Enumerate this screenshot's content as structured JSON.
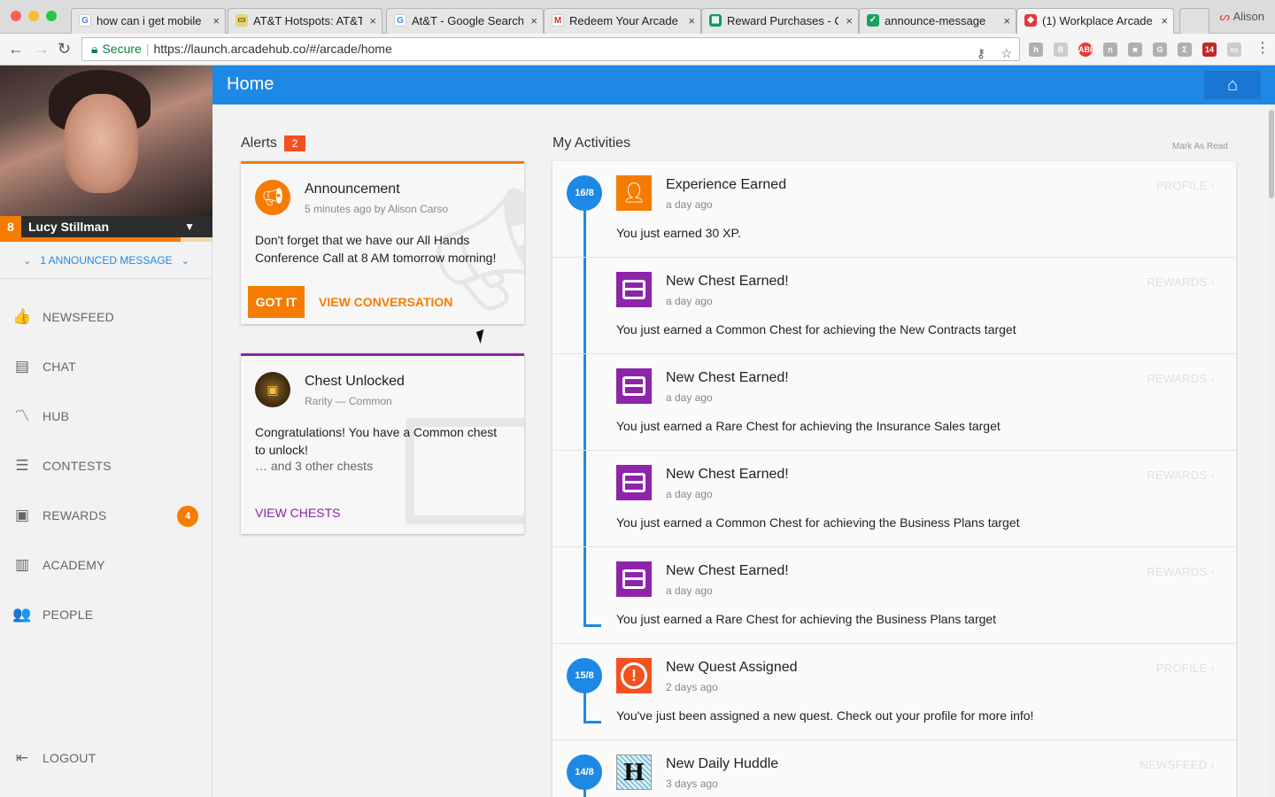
{
  "browser": {
    "tabs": [
      {
        "title": "how can i get mobile",
        "favicon": "google-icon",
        "color": "#4285f4"
      },
      {
        "title": "AT&T Hotspots: AT&T",
        "favicon": "ticket-icon",
        "color": "#c8a400"
      },
      {
        "title": "At&T - Google Search",
        "favicon": "google-icon",
        "color": "#4285f4"
      },
      {
        "title": "Redeem Your Arcade",
        "favicon": "gmail-icon",
        "color": "#d93025"
      },
      {
        "title": "Reward Purchases - C",
        "favicon": "sheets-icon",
        "color": "#0f9d58"
      },
      {
        "title": "announce-message",
        "favicon": "checkmark-icon",
        "color": "#1aa260"
      },
      {
        "title": "(1) Workplace Arcade",
        "favicon": "arcade-icon",
        "color": "#e53935"
      }
    ],
    "profile_name": "Alison",
    "secure_label": "Secure",
    "url": "https://launch.arcadehub.co/#/arcade/home"
  },
  "user": {
    "name": "Lucy Stillman",
    "level": "8",
    "xp_progress": 0.85
  },
  "sidebar": {
    "announced_message": "1 ANNOUNCED MESSAGE",
    "items": [
      {
        "label": "NEWSFEED",
        "icon": "thumbs-up-icon",
        "glyph": "👍"
      },
      {
        "label": "CHAT",
        "icon": "chat-icon",
        "glyph": "▤"
      },
      {
        "label": "HUB",
        "icon": "trending-icon",
        "glyph": "〽"
      },
      {
        "label": "CONTESTS",
        "icon": "list-icon",
        "glyph": "☰"
      },
      {
        "label": "REWARDS",
        "icon": "gift-icon",
        "glyph": "▣",
        "badge": "4"
      },
      {
        "label": "ACADEMY",
        "icon": "bar-chart-icon",
        "glyph": "▥"
      },
      {
        "label": "PEOPLE",
        "icon": "people-icon",
        "glyph": "👥"
      }
    ],
    "logout": "LOGOUT"
  },
  "header": {
    "title": "Home"
  },
  "alerts": {
    "title": "Alerts",
    "count": "2",
    "announcement": {
      "title": "Announcement",
      "subtitle": "5 minutes ago by Alison Carso",
      "body": "Don't forget that we have our All Hands Conference Call at 8 AM tomorrow morning!",
      "got_it": "GOT IT",
      "view_conversation": "VIEW CONVERSATION",
      "accent": "#f57c00"
    },
    "chest": {
      "title": "Chest Unlocked",
      "subtitle": "Rarity — Common",
      "body": "Congratulations! You have a Common chest to unlock!",
      "more": "… and 3 other chests",
      "view_chests": "VIEW CHESTS",
      "accent": "#8e24aa"
    }
  },
  "activities": {
    "title": "My Activities",
    "mark_as_read": "Mark As Read",
    "items": [
      {
        "date": "16/8",
        "type": "xp",
        "icon": "add-person-icon",
        "title": "Experience Earned",
        "time": "a day ago",
        "link": "PROFILE",
        "body": "You just earned 30 XP."
      },
      {
        "date": "",
        "type": "chest",
        "icon": "chest-icon",
        "title": "New Chest Earned!",
        "time": "a day ago",
        "link": "REWARDS",
        "body": "You just earned a Common Chest for achieving the New Contracts target"
      },
      {
        "date": "",
        "type": "chest",
        "icon": "chest-icon",
        "title": "New Chest Earned!",
        "time": "a day ago",
        "link": "REWARDS",
        "body": "You just earned a Rare Chest for achieving the Insurance Sales target"
      },
      {
        "date": "",
        "type": "chest",
        "icon": "chest-icon",
        "title": "New Chest Earned!",
        "time": "a day ago",
        "link": "REWARDS",
        "body": "You just earned a Common Chest for achieving the Business Plans target"
      },
      {
        "date": "",
        "type": "chest",
        "icon": "chest-icon",
        "title": "New Chest Earned!",
        "time": "a day ago",
        "link": "REWARDS",
        "body": "You just earned a Rare Chest for achieving the Business Plans target"
      },
      {
        "date": "15/8",
        "type": "quest",
        "icon": "alert-icon",
        "title": "New Quest Assigned",
        "time": "2 days ago",
        "link": "PROFILE",
        "body": "You've just been assigned a new quest. Check out your profile for more info!"
      },
      {
        "date": "14/8",
        "type": "huddle",
        "icon": "huddle-icon",
        "title": "New Daily Huddle",
        "time": "3 days ago",
        "link": "NEWSFEED",
        "body": ""
      }
    ]
  },
  "colors": {
    "primary": "#1e88e5",
    "accent": "#f57c00",
    "purple": "#8e24aa"
  }
}
